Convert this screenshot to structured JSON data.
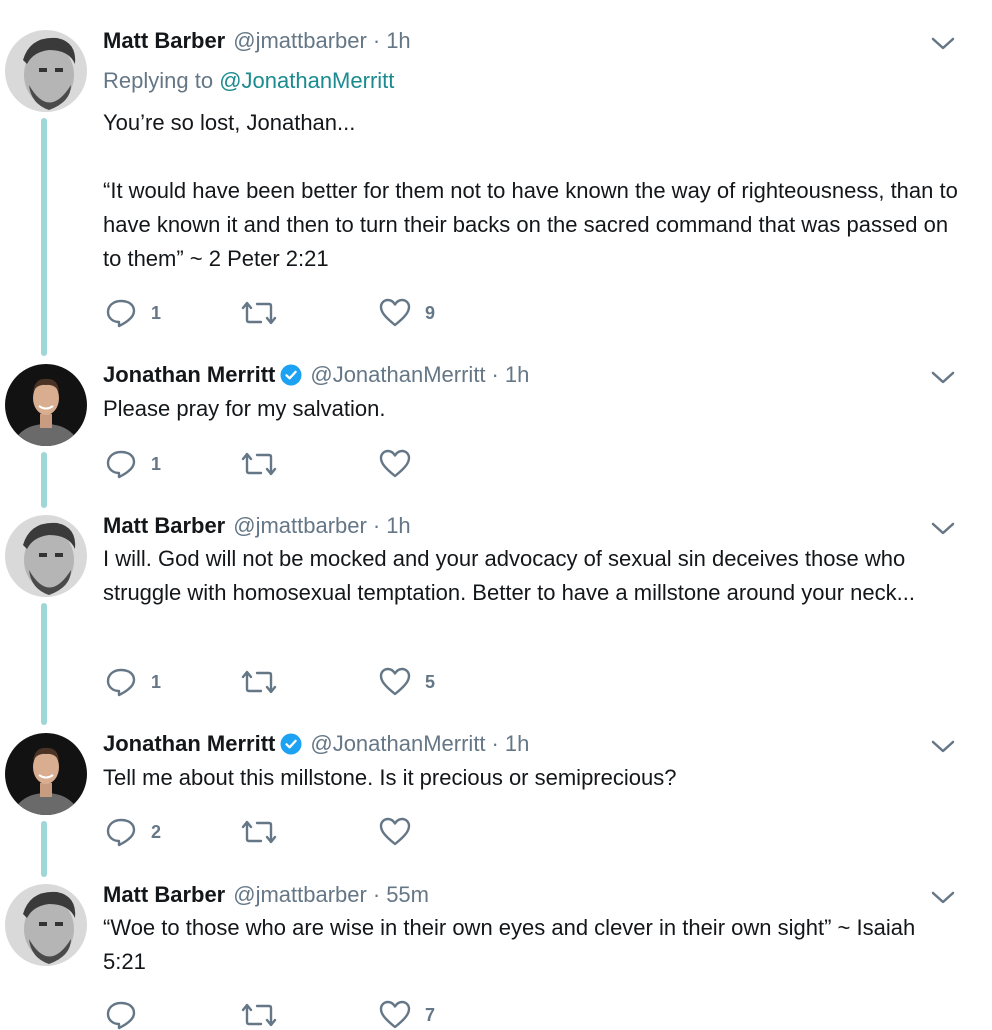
{
  "tweets": [
    {
      "name": "Matt Barber",
      "handle": "@jmattbarber",
      "time": "1h",
      "replying_prefix": "Replying to",
      "replying_handle": "@JonathanMerritt",
      "text": "You’re so lost, Jonathan...\n\n“It would have been better for them not to have known the way of righteousness, than to have known it and then to turn their backs on the sacred command that was passed on to them” ~ 2 Peter 2:21",
      "replies": "1",
      "retweets": "",
      "likes": "9"
    },
    {
      "name": "Jonathan Merritt",
      "handle": "@JonathanMerritt",
      "time": "1h",
      "verified": true,
      "text": "Please pray for my salvation.",
      "replies": "1",
      "retweets": "",
      "likes": ""
    },
    {
      "name": "Matt Barber",
      "handle": "@jmattbarber",
      "time": "1h",
      "text": "I will. God will not be mocked and your advocacy of sexual sin deceives those who struggle with homosexual temptation. Better to have a millstone around your neck...",
      "replies": "1",
      "retweets": "",
      "likes": "5"
    },
    {
      "name": "Jonathan Merritt",
      "handle": "@JonathanMerritt",
      "time": "1h",
      "verified": true,
      "text": "Tell me about this millstone. Is it precious or semiprecious?",
      "replies": "2",
      "retweets": "",
      "likes": ""
    },
    {
      "name": "Matt Barber",
      "handle": "@jmattbarber",
      "time": "55m",
      "text": "“Woe to those who are wise in their own eyes and clever in their own sight” ~ Isaiah 5:21",
      "replies": "",
      "retweets": "",
      "likes": "7"
    }
  ],
  "colors": {
    "thread_line": "#9fd6d8",
    "reply_link": "#1b8b8f",
    "secondary_text": "#657786",
    "verified_badge": "#1da1f2"
  },
  "icons": [
    "reply-icon",
    "retweet-icon",
    "heart-icon",
    "chevron-down-icon",
    "verified-badge-icon"
  ]
}
